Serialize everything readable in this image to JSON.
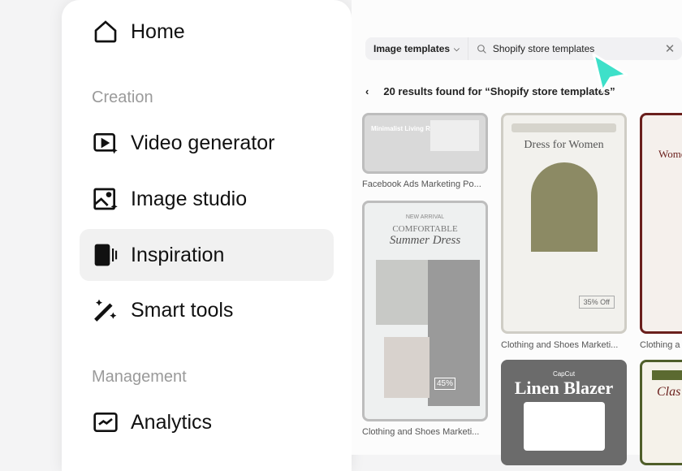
{
  "sidebar": {
    "home": "Home",
    "creation": "Creation",
    "video_generator": "Video generator",
    "image_studio": "Image studio",
    "inspiration": "Inspiration",
    "smart_tools": "Smart tools",
    "management": "Management",
    "analytics": "Analytics"
  },
  "search": {
    "category": "Image templates",
    "query": "Shopify store templates"
  },
  "results": {
    "text": "20 results found for “Shopify store templates”"
  },
  "cards": [
    {
      "label": "Facebook Ads Marketing Po...",
      "inner": "Minimalist Living Room"
    },
    {
      "label": "Clothing and Shoes Marketi...",
      "inner_top": "NEW ARRIVAL",
      "inner_title": "COMFORTABLE",
      "inner_script": "Summer Dress",
      "badge": "45%"
    },
    {
      "label": "Clothing and Shoes Marketi...",
      "inner": "Dress for Women",
      "badge": "35% Off"
    },
    {
      "label": "Clothing a",
      "inner": "Wome"
    },
    {
      "inner_brand": "CapCut",
      "inner": "Linen Blazer"
    },
    {
      "inner": "Clas"
    }
  ],
  "colors": {
    "accent": "#3ee0c9"
  }
}
